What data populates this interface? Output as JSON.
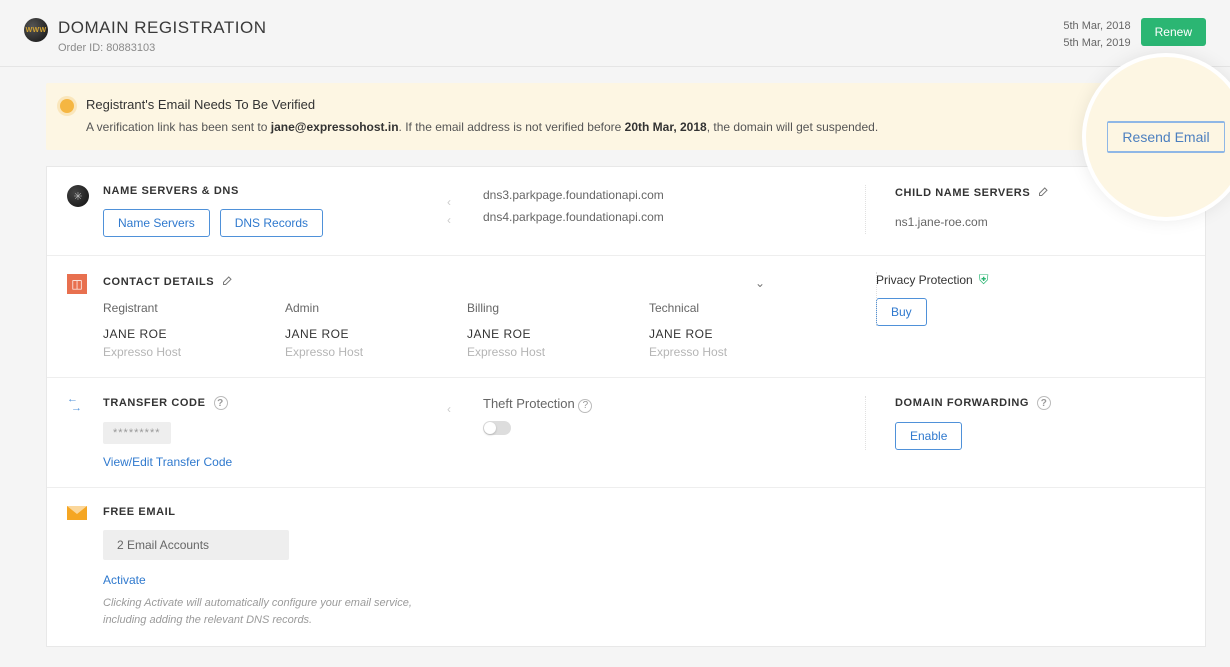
{
  "header": {
    "www_icon_label": "WWW",
    "title": "DOMAIN REGISTRATION",
    "order_label": "Order ID:",
    "order_id": "80883103",
    "date_start": "5th Mar, 2018",
    "date_end": "5th Mar, 2019",
    "renew": "Renew"
  },
  "alert": {
    "title": "Registrant's Email Needs To Be Verified",
    "body_pre": "A verification link has been sent to ",
    "email": "jane@expressohost.in",
    "body_mid": ". If the email address is not verified before ",
    "deadline": "20th Mar, 2018",
    "body_post": ", the domain will get suspended.",
    "resend": "Resend Email"
  },
  "ns": {
    "title": "NAME SERVERS & DNS",
    "btn_ns": "Name Servers",
    "btn_dns": "DNS Records",
    "servers": [
      "dns3.parkpage.foundationapi.com",
      "dns4.parkpage.foundationapi.com"
    ],
    "child_title": "CHILD NAME SERVERS",
    "child_value": "ns1.jane-roe.com"
  },
  "contacts": {
    "title": "CONTACT DETAILS",
    "cols": [
      {
        "label": "Registrant",
        "name": "JANE ROE",
        "org": "Expresso Host"
      },
      {
        "label": "Admin",
        "name": "JANE ROE",
        "org": "Expresso Host"
      },
      {
        "label": "Billing",
        "name": "JANE ROE",
        "org": "Expresso Host"
      },
      {
        "label": "Technical",
        "name": "JANE ROE",
        "org": "Expresso Host"
      }
    ],
    "privacy_title": "Privacy Protection",
    "buy": "Buy"
  },
  "transfer": {
    "title": "TRANSFER CODE",
    "masked": "*********",
    "link": "View/Edit Transfer Code",
    "theft_title": "Theft Protection",
    "forward_title": "DOMAIN FORWARDING",
    "enable": "Enable"
  },
  "email": {
    "title": "FREE EMAIL",
    "accounts": "2 Email Accounts",
    "activate": "Activate",
    "note": "Clicking Activate will automatically configure your email service, including adding the relevant DNS records."
  }
}
